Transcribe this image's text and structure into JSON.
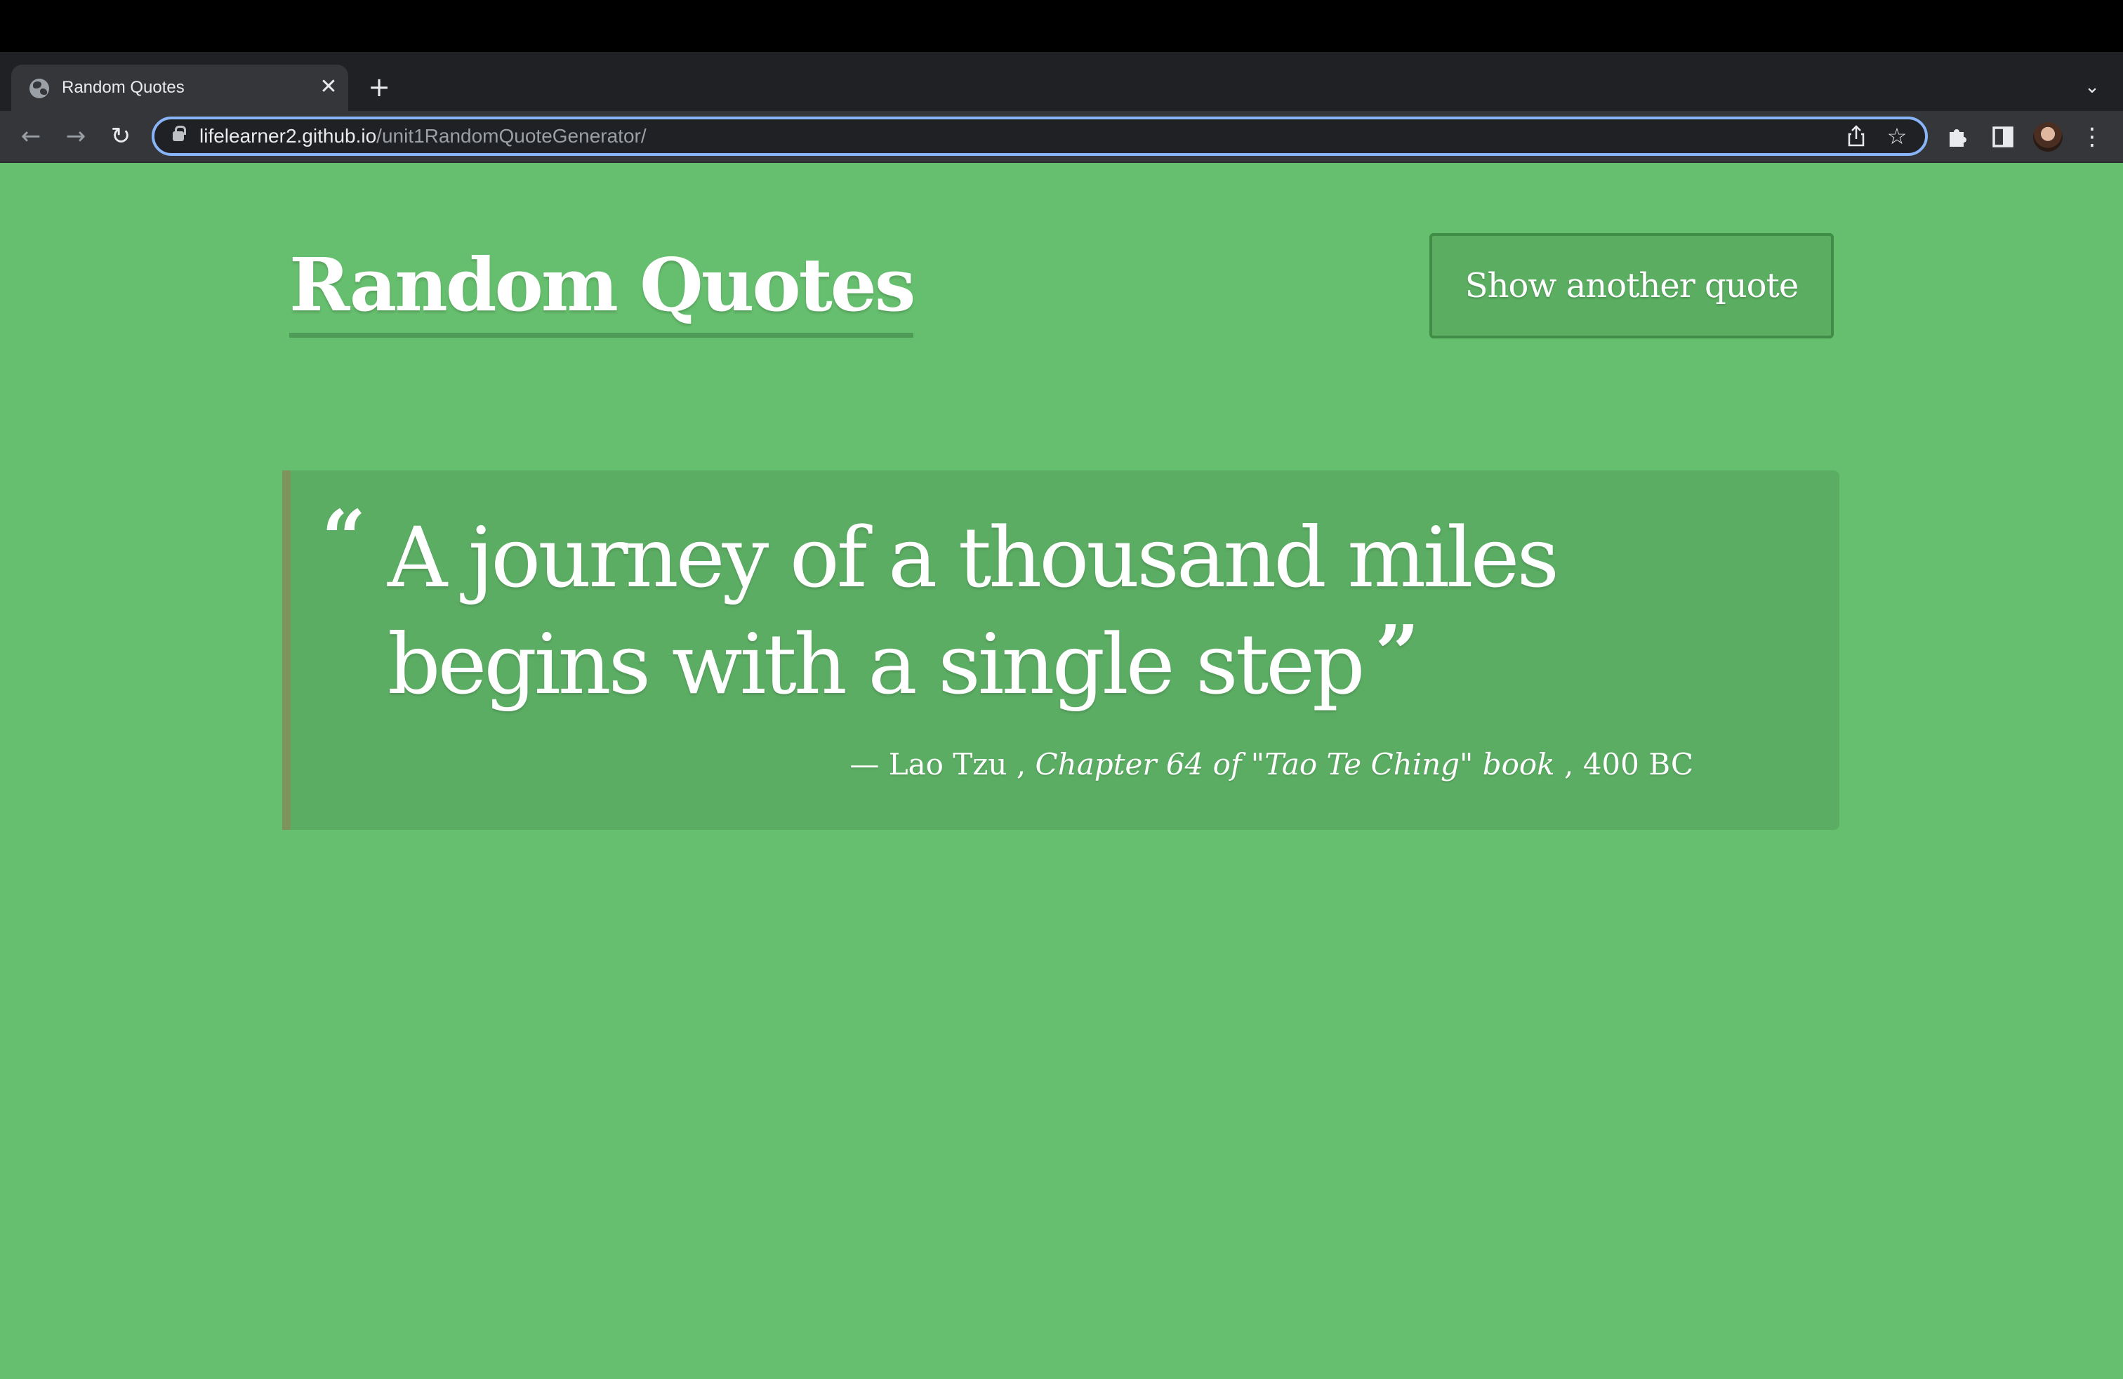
{
  "browser": {
    "tab": {
      "title": "Random Quotes",
      "close_glyph": "✕"
    },
    "new_tab_glyph": "+",
    "tab_search_glyph": "⌄",
    "nav": {
      "back_glyph": "←",
      "forward_glyph": "→",
      "reload_glyph": "↻"
    },
    "address": {
      "host": "lifelearner2.github.io",
      "path": "/unit1RandomQuoteGenerator/"
    },
    "bookmark_glyph": "☆",
    "menu_glyph": "⋮",
    "icons": [
      "globe-icon",
      "close-icon",
      "plus-icon",
      "chevron-down-icon",
      "back-arrow-icon",
      "forward-arrow-icon",
      "reload-icon",
      "lock-icon",
      "share-icon",
      "star-icon",
      "puzzle-icon",
      "side-panel-icon",
      "avatar",
      "kebab-menu-icon"
    ]
  },
  "page": {
    "title": "Random Quotes",
    "button_label": "Show another quote",
    "quote": {
      "open_mark": "“",
      "text": "A journey of a thousand miles begins with a single step",
      "close_mark": "”",
      "citation_prefix": "— Lao Tzu ,",
      "source_book": "Chapter 64 of \"Tao Te Ching\" book",
      "year": ", 400 BC"
    }
  },
  "colors": {
    "page_background": "#66bf6e",
    "quote_box": "#5cad64",
    "quote_border": "#7e945c",
    "button_fill": "#5aad61",
    "button_border": "#3f8d47",
    "title_underline": "#4e9a57",
    "omnibox_focus": "#8ab4f8"
  }
}
